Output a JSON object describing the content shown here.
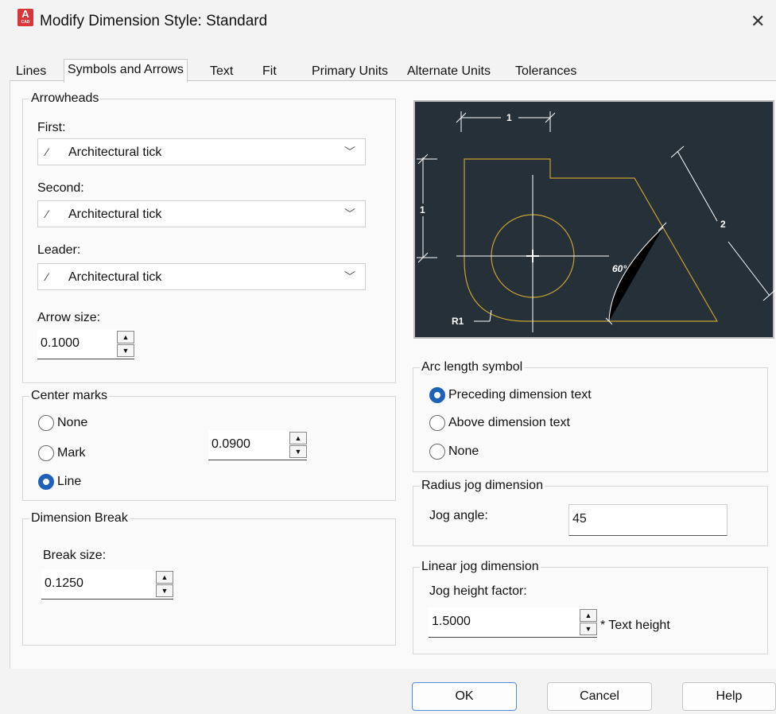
{
  "window": {
    "title": "Modify Dimension Style: Standard",
    "app_icon_letter": "A",
    "app_icon_sub": "CAD",
    "close_glyph": "✕"
  },
  "tabs": [
    {
      "label": "Lines"
    },
    {
      "label": "Symbols and Arrows"
    },
    {
      "label": "Text"
    },
    {
      "label": "Fit"
    },
    {
      "label": "Primary Units"
    },
    {
      "label": "Alternate Units"
    },
    {
      "label": "Tolerances"
    }
  ],
  "arrowheads": {
    "title": "Arrowheads",
    "first_label": "First:",
    "first_value": "Architectural tick",
    "second_label": "Second:",
    "second_value": "Architectural tick",
    "leader_label": "Leader:",
    "leader_value": "Architectural tick",
    "arrow_size_label": "Arrow size:",
    "arrow_size_value": "0.1000"
  },
  "center_marks": {
    "title": "Center marks",
    "options": [
      {
        "label": "None",
        "selected": false
      },
      {
        "label": "Mark",
        "selected": false
      },
      {
        "label": "Line",
        "selected": true
      }
    ],
    "size_value": "0.0900"
  },
  "dimension_break": {
    "title": "Dimension Break",
    "break_size_label": "Break size:",
    "break_size_value": "0.1250"
  },
  "preview": {
    "dim_top": "1",
    "dim_left": "1",
    "dim_right": "2",
    "angle": "60°",
    "radius": "R1",
    "colors": {
      "background": "#263038",
      "lines": "#ffffff",
      "geometry": "#c8a032"
    }
  },
  "arc_length_symbol": {
    "title": "Arc length symbol",
    "options": [
      {
        "label": "Preceding dimension text",
        "selected": true
      },
      {
        "label": "Above dimension text",
        "selected": false
      },
      {
        "label": "None",
        "selected": false
      }
    ]
  },
  "radius_jog": {
    "title": "Radius jog dimension",
    "jog_angle_label": "Jog angle:",
    "jog_angle_value": "45"
  },
  "linear_jog": {
    "title": "Linear jog dimension",
    "height_factor_label": "Jog height factor:",
    "height_factor_value": "1.5000",
    "suffix": "* Text height"
  },
  "buttons": {
    "ok": "OK",
    "cancel": "Cancel",
    "help": "Help"
  }
}
